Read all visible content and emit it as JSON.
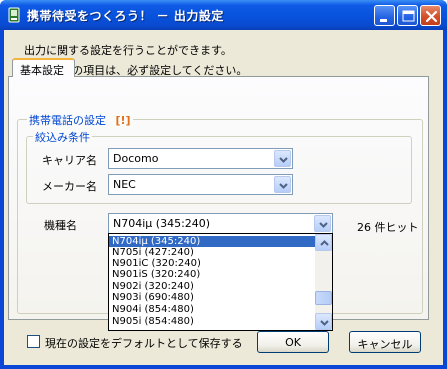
{
  "window": {
    "title": "携帯待受をつくろう！ － 出力設定",
    "colors": {
      "titlebar": "#0852dc",
      "client": "#ece9d8",
      "required_mark": "#e0701c",
      "group_title": "#0046d5",
      "selection": "#316ac5"
    }
  },
  "description": {
    "line1": "出力に関する設定を行うことができます。",
    "line2_mark": "[!]",
    "line2_text": "マークの項目は、必ず設定してください。"
  },
  "tab": {
    "label": "基本設定"
  },
  "phone_settings": {
    "title": "携帯電話の設定",
    "required_mark": "[!]",
    "filter": {
      "title": "絞込み条件",
      "carrier_label": "キャリア名",
      "carrier_value": "Docomo",
      "maker_label": "メーカー名",
      "maker_value": "NEC"
    },
    "model_label": "機種名",
    "model_value": "N704iμ (345:240)",
    "hit_count": "26 件ヒット",
    "model_options": [
      "N704iμ (345:240)",
      "N705i (427:240)",
      "N901iC (320:240)",
      "N901iS (320:240)",
      "N902i (320:240)",
      "N903i (690:480)",
      "N904i (854:480)",
      "N905i (854:480)"
    ]
  },
  "footer": {
    "save_default_label": "現在の設定をデフォルトとして保存する",
    "ok_label": "OK",
    "cancel_label": "キャンセル"
  }
}
